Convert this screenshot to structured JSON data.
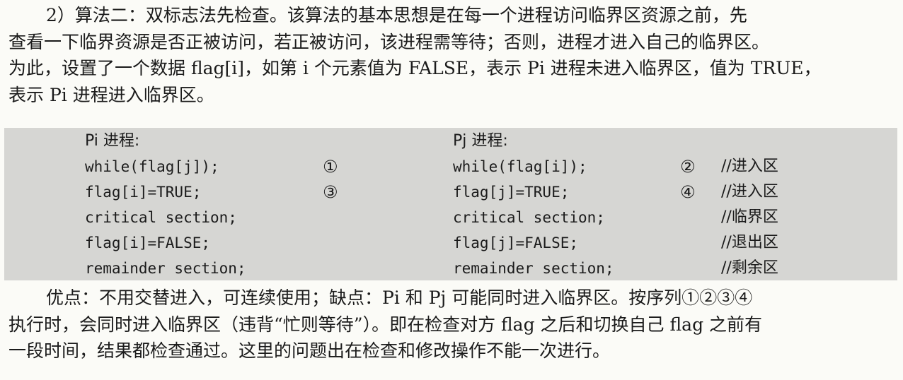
{
  "intro": {
    "lines": [
      "2）算法二：双标志法先检查。该算法的基本思想是在每一个进程访问临界区资源之前，先",
      "查看一下临界资源是否正被访问，若正被访问，该进程需等待；否则，进程才进入自己的临界区。",
      "为此，设置了一个数据 flag[i]，如第 i 个元素值为 FALSE，表示 Pi 进程未进入临界区，值为 TRUE，",
      "表示 Pi 进程进入临界区。"
    ]
  },
  "code": {
    "left_header": "Pi 进程:",
    "right_header": "Pj 进程:",
    "rows": [
      {
        "left": "while(flag[j]);",
        "left_num": "①",
        "right": "while(flag[i]);",
        "right_num": "②",
        "comment": "//进入区"
      },
      {
        "left": "flag[i]=TRUE;",
        "left_num": "③",
        "right": "flag[j]=TRUE;",
        "right_num": "④",
        "comment": "//进入区"
      },
      {
        "left": "critical section;",
        "left_num": "",
        "right": "critical section;",
        "right_num": "",
        "comment": "//临界区"
      },
      {
        "left": "flag[i]=FALSE;",
        "left_num": "",
        "right": "flag[j]=FALSE;",
        "right_num": "",
        "comment": "//退出区"
      },
      {
        "left": "remainder section;",
        "left_num": "",
        "right": "remainder section;",
        "right_num": "",
        "comment": "//剩余区"
      }
    ]
  },
  "outro": {
    "lines": [
      "优点：不用交替进入，可连续使用；缺点：Pi 和 Pj 可能同时进入临界区。按序列①②③④",
      "执行时，会同时进入临界区（违背“忙则等待”）。即在检查对方 flag 之后和切换自己 flag 之前有",
      "一段时间，结果都检查通过。这里的问题出在检查和修改操作不能一次进行。"
    ]
  }
}
